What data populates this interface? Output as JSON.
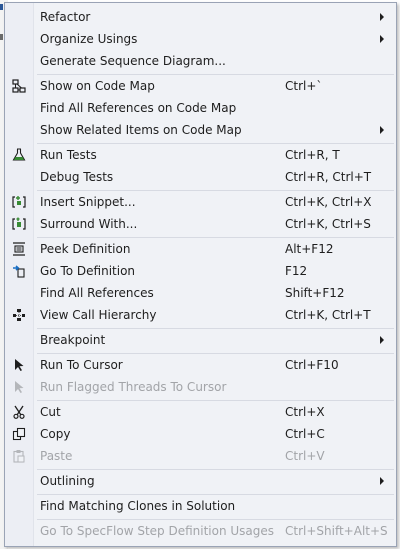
{
  "menu": {
    "refactor": {
      "label": "Refactor"
    },
    "organize_usings": {
      "label": "Organize Usings"
    },
    "generate_sequence": {
      "label": "Generate Sequence Diagram..."
    },
    "show_code_map": {
      "label": "Show on Code Map",
      "shortcut": "Ctrl+`",
      "icon": "code-map-icon"
    },
    "find_refs_code_map": {
      "label": "Find All References on Code Map"
    },
    "show_related": {
      "label": "Show Related Items on Code Map"
    },
    "run_tests": {
      "label": "Run Tests",
      "shortcut": "Ctrl+R, T",
      "icon": "flask-icon"
    },
    "debug_tests": {
      "label": "Debug Tests",
      "shortcut": "Ctrl+R, Ctrl+T"
    },
    "insert_snippet": {
      "label": "Insert Snippet...",
      "shortcut": "Ctrl+K, Ctrl+X",
      "icon": "snippet-icon"
    },
    "surround_with": {
      "label": "Surround With...",
      "shortcut": "Ctrl+K, Ctrl+S",
      "icon": "surround-icon"
    },
    "peek_definition": {
      "label": "Peek Definition",
      "shortcut": "Alt+F12",
      "icon": "peek-icon"
    },
    "go_to_definition": {
      "label": "Go To Definition",
      "shortcut": "F12",
      "icon": "goto-definition-icon"
    },
    "find_all_refs": {
      "label": "Find All References",
      "shortcut": "Shift+F12"
    },
    "view_call_hierarchy": {
      "label": "View Call Hierarchy",
      "shortcut": "Ctrl+K, Ctrl+T",
      "icon": "call-hierarchy-icon"
    },
    "breakpoint": {
      "label": "Breakpoint"
    },
    "run_to_cursor": {
      "label": "Run To Cursor",
      "shortcut": "Ctrl+F10",
      "icon": "cursor-icon"
    },
    "run_flagged_threads": {
      "label": "Run Flagged Threads To Cursor",
      "icon": "cursor-icon"
    },
    "cut": {
      "label": "Cut",
      "shortcut": "Ctrl+X",
      "icon": "scissors-icon"
    },
    "copy": {
      "label": "Copy",
      "shortcut": "Ctrl+C",
      "icon": "copy-icon"
    },
    "paste": {
      "label": "Paste",
      "shortcut": "Ctrl+V",
      "icon": "paste-icon"
    },
    "outlining": {
      "label": "Outlining"
    },
    "find_matching_clones": {
      "label": "Find Matching Clones in Solution"
    },
    "specflow_step": {
      "label": "Go To SpecFlow Step Definition Usages",
      "shortcut": "Ctrl+Shift+Alt+S"
    }
  },
  "colors": {
    "menu_bg": "#f0f2f6",
    "text": "#1e1e1e",
    "disabled_text": "#a2a4a8",
    "icon_green": "#388a34",
    "icon_blue": "#1a6fc4"
  }
}
